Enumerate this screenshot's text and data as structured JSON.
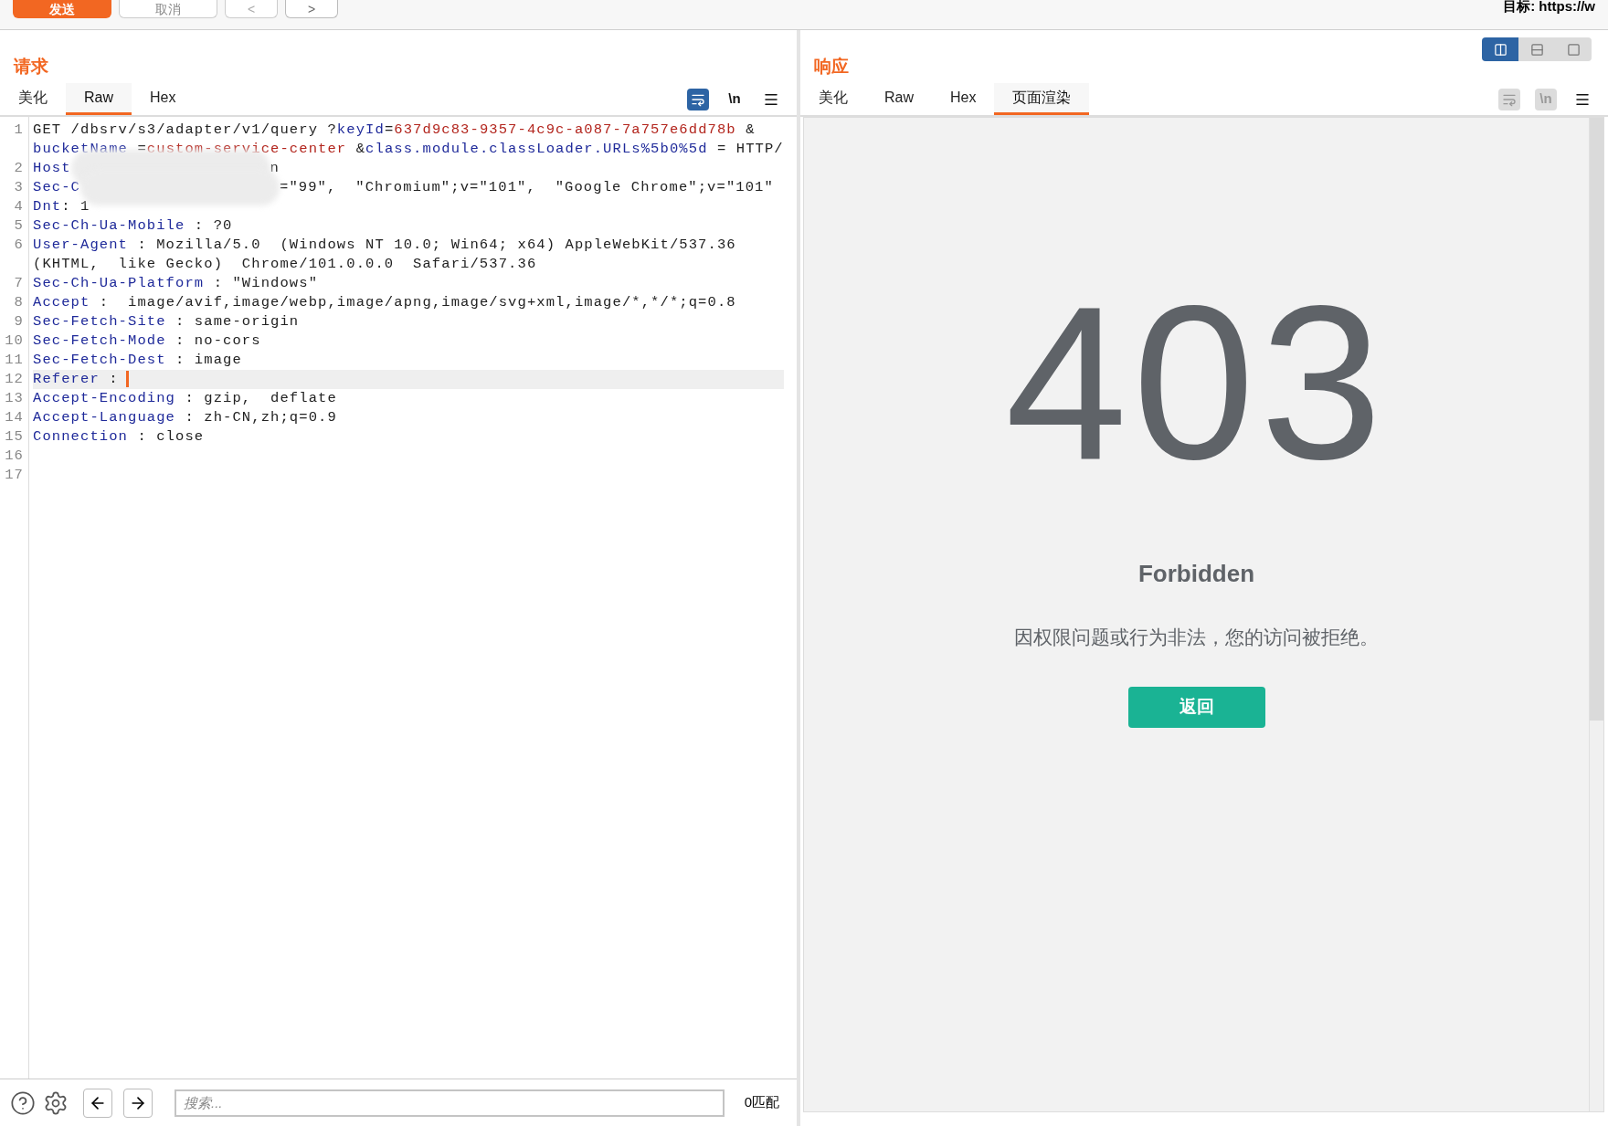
{
  "toolbar": {
    "send_button": "发送",
    "cancel_button": "取消",
    "back_button": "<",
    "forward_button": ">",
    "target": "目标: https://w"
  },
  "request": {
    "title": "请求",
    "tabs": [
      {
        "label": "美化",
        "selected": false
      },
      {
        "label": "Raw",
        "selected": true
      },
      {
        "label": "Hex",
        "selected": false
      }
    ],
    "tools": [
      {
        "kind": "wrap",
        "active": true,
        "disabled": false
      },
      {
        "kind": "newline",
        "label": "\\n",
        "active": false,
        "disabled": false
      },
      {
        "kind": "menu",
        "active": false,
        "disabled": false
      }
    ],
    "code_lines": [
      {
        "number": "1",
        "current": false,
        "tokens": [
          {
            "kind": "plain",
            "text": "GET /dbsrv/s3/adapter/v1/query ?"
          },
          {
            "kind": "key",
            "text": "keyId"
          },
          {
            "kind": "plain",
            "text": "="
          },
          {
            "kind": "value",
            "text": "637d9c83-9357-4c9c-a087-7a757e6dd78b"
          },
          {
            "kind": "plain",
            "text": " & "
          },
          {
            "kind": "key",
            "text": "bucketName"
          },
          {
            "kind": "plain",
            "text": " ="
          },
          {
            "kind": "value",
            "text": "custom-service-center"
          },
          {
            "kind": "plain",
            "text": " &"
          },
          {
            "kind": "key",
            "text": "class.module.classLoader.URLs%5b0%5d"
          },
          {
            "kind": "plain",
            "text": " = HTTP/"
          }
        ]
      },
      {
        "number": "2",
        "current": false,
        "tokens": [
          {
            "kind": "key",
            "text": "Host"
          },
          {
            "kind": "blur"
          },
          {
            "kind": "plain",
            "text": "n"
          }
        ]
      },
      {
        "number": "3",
        "current": false,
        "tokens": [
          {
            "kind": "key",
            "text": "Sec-C"
          },
          {
            "kind": "blur"
          },
          {
            "kind": "plain",
            "text": "=\"99\",  \"Chromium\";v=\"101\",  \"Google Chrome\";v=\"101\""
          }
        ]
      },
      {
        "number": "4",
        "current": false,
        "tokens": [
          {
            "kind": "key",
            "text": "Dnt"
          },
          {
            "kind": "plain",
            "text": ": 1"
          }
        ]
      },
      {
        "number": "5",
        "current": false,
        "tokens": [
          {
            "kind": "key",
            "text": "Sec-Ch-Ua-Mobile"
          },
          {
            "kind": "plain",
            "text": " : ?0"
          }
        ]
      },
      {
        "number": "6",
        "current": false,
        "tokens": [
          {
            "kind": "key",
            "text": "User-Agent"
          },
          {
            "kind": "plain",
            "text": " : Mozilla/5.0  (Windows NT 10.0; Win64; x64) AppleWebKit/537.36 (KHTML,  like Gecko)  Chrome/101.0.0.0  Safari/537.36"
          }
        ]
      },
      {
        "number": "7",
        "current": false,
        "tokens": [
          {
            "kind": "key",
            "text": "Sec-Ch-Ua-Platform"
          },
          {
            "kind": "plain",
            "text": " : \"Windows\""
          }
        ]
      },
      {
        "number": "8",
        "current": false,
        "tokens": [
          {
            "kind": "key",
            "text": "Accept"
          },
          {
            "kind": "plain",
            "text": " :  image/avif,image/webp,image/apng,image/svg+xml,image/*,*/*;q=0.8"
          }
        ]
      },
      {
        "number": "9",
        "current": false,
        "tokens": [
          {
            "kind": "key",
            "text": "Sec-Fetch-Site"
          },
          {
            "kind": "plain",
            "text": " : same-origin"
          }
        ]
      },
      {
        "number": "10",
        "current": false,
        "tokens": [
          {
            "kind": "key",
            "text": "Sec-Fetch-Mode"
          },
          {
            "kind": "plain",
            "text": " : no-cors"
          }
        ]
      },
      {
        "number": "11",
        "current": false,
        "tokens": [
          {
            "kind": "key",
            "text": "Sec-Fetch-Dest"
          },
          {
            "kind": "plain",
            "text": " : image"
          }
        ]
      },
      {
        "number": "12",
        "current": true,
        "tokens": [
          {
            "kind": "key",
            "text": "Referer"
          },
          {
            "kind": "plain",
            "text": " :"
          }
        ]
      },
      {
        "number": "13",
        "current": false,
        "tokens": [
          {
            "kind": "key",
            "text": "Accept-Encoding"
          },
          {
            "kind": "plain",
            "text": " : gzip,  deflate"
          }
        ]
      },
      {
        "number": "14",
        "current": false,
        "tokens": [
          {
            "kind": "key",
            "text": "Accept-Language"
          },
          {
            "kind": "plain",
            "text": " : zh-CN,zh;q=0.9"
          }
        ]
      },
      {
        "number": "15",
        "current": false,
        "tokens": [
          {
            "kind": "key",
            "text": "Connection"
          },
          {
            "kind": "plain",
            "text": " : close"
          }
        ]
      },
      {
        "number": "16",
        "current": false
      },
      {
        "number": "17",
        "current": false
      }
    ],
    "search": {
      "placeholder": "搜索...",
      "matches": "0匹配"
    }
  },
  "response": {
    "title": "响应",
    "layout_modes": [
      {
        "kind": "columns",
        "selected": true
      },
      {
        "kind": "rows",
        "selected": false
      },
      {
        "kind": "single",
        "selected": false
      }
    ],
    "tabs": [
      {
        "label": "美化",
        "selected": false
      },
      {
        "label": "Raw",
        "selected": false
      },
      {
        "label": "Hex",
        "selected": false
      },
      {
        "label": "页面渲染",
        "selected": true
      }
    ],
    "tools": [
      {
        "kind": "wrap",
        "disabled": true
      },
      {
        "kind": "newline",
        "label": "\\n",
        "disabled": true
      },
      {
        "kind": "menu",
        "active": false,
        "disabled": false
      }
    ],
    "rendered_page": {
      "status_code": "403",
      "heading": "Forbidden",
      "message": "因权限问题或行为非法，您的访问被拒绝。",
      "button": "返回"
    }
  }
}
